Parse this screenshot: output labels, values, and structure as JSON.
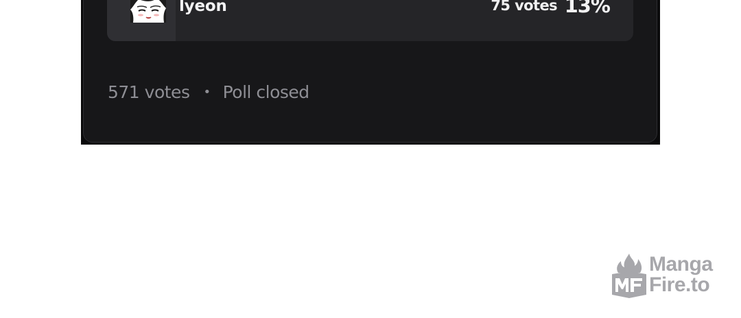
{
  "poll": {
    "answer": {
      "label": "lyeon",
      "votes": "75 votes",
      "percent": "13%"
    },
    "total_votes": "571 votes",
    "separator": "•",
    "status": "Poll closed"
  },
  "watermark": {
    "line1": "Manga",
    "line2": "Fire.to"
  },
  "colors": {
    "frame": "#0a0a0b",
    "card": "#171719",
    "answer_row": "#252528",
    "footer_text": "#8e8e94",
    "watermark": "#a7a7ab"
  }
}
